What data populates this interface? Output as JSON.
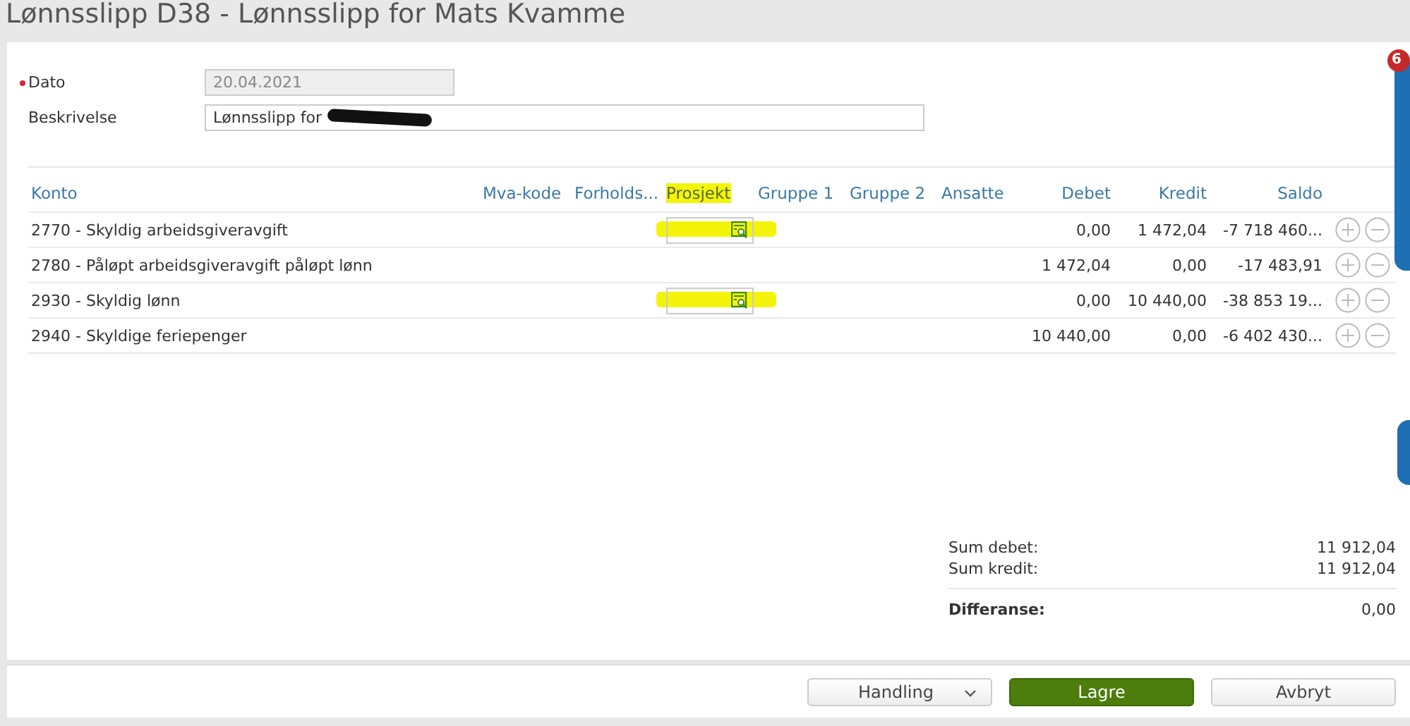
{
  "window": {
    "title": "Lønnsslipp D38  -  Lønnsslipp for Mats Kvamme"
  },
  "form": {
    "date": {
      "label": "Dato",
      "required": true,
      "value": "20.04.2021",
      "disabled": true
    },
    "description": {
      "label": "Beskrivelse",
      "value": "Lønnsslipp for",
      "redacted": true
    }
  },
  "table": {
    "columns": [
      {
        "label": "Konto",
        "highlighted": false
      },
      {
        "label": "Mva-kode",
        "highlighted": false
      },
      {
        "label": "Forholds...",
        "highlighted": false
      },
      {
        "label": "Prosjekt",
        "highlighted": true
      },
      {
        "label": "Gruppe 1",
        "highlighted": false
      },
      {
        "label": "Gruppe 2",
        "highlighted": false
      },
      {
        "label": "Ansatte",
        "highlighted": false
      },
      {
        "label": "Debet",
        "highlighted": false
      },
      {
        "label": "Kredit",
        "highlighted": false
      },
      {
        "label": "Saldo",
        "highlighted": false
      }
    ],
    "rows": [
      {
        "account": "2770 - Skyldig arbeidsgiveravgift",
        "project_field": true,
        "highlighted": true,
        "debet": "0,00",
        "kredit": "1 472,04",
        "saldo": "-7 718 460..."
      },
      {
        "account": "2780 - Påløpt arbeidsgiveravgift påløpt lønn",
        "project_field": false,
        "highlighted": false,
        "debet": "1 472,04",
        "kredit": "0,00",
        "saldo": "-17 483,91"
      },
      {
        "account": "2930 - Skyldig lønn",
        "project_field": true,
        "highlighted": true,
        "debet": "0,00",
        "kredit": "10 440,00",
        "saldo": "-38 853 19..."
      },
      {
        "account": "2940 - Skyldige feriepenger",
        "project_field": false,
        "highlighted": false,
        "debet": "10 440,00",
        "kredit": "0,00",
        "saldo": "-6 402 430..."
      }
    ]
  },
  "totals": [
    {
      "label": "Sum debet:",
      "value": "11 912,04",
      "bold": false
    },
    {
      "label": "Sum kredit:",
      "value": "11 912,04",
      "bold": false
    },
    {
      "label": "Differanse:",
      "value": "0,00",
      "bold": true
    }
  ],
  "side_badge": "6",
  "buttons": [
    {
      "label": "Handling",
      "kind": "dropdown"
    },
    {
      "label": "Lagre",
      "kind": "primary"
    },
    {
      "label": "Avbryt",
      "kind": "default"
    }
  ]
}
